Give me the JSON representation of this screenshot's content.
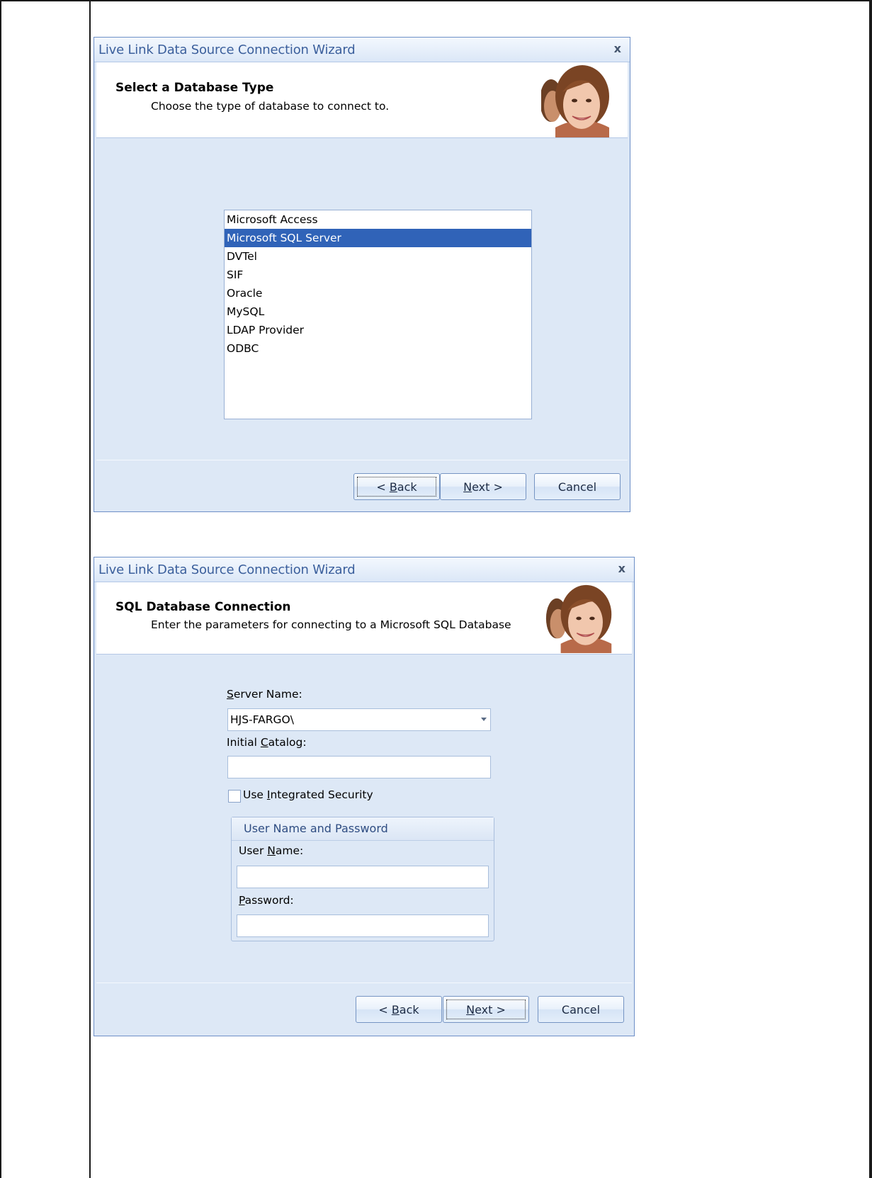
{
  "wizard1": {
    "title": "Live Link Data Source Connection Wizard",
    "close_glyph": "x",
    "header_title": "Select a Database Type",
    "header_subtitle": "Choose the type of database to connect to.",
    "database_types": [
      "Microsoft Access",
      "Microsoft SQL Server",
      "DVTel",
      "SIF",
      "Oracle",
      "MySQL",
      "LDAP Provider",
      "ODBC"
    ],
    "selected_type": "Microsoft SQL Server",
    "buttons": {
      "back_prefix": "< ",
      "back_key": "B",
      "back_rest": "ack",
      "next_key": "N",
      "next_rest": "ext >",
      "cancel": "Cancel"
    }
  },
  "wizard2": {
    "title": "Live Link Data Source Connection Wizard",
    "close_glyph": "x",
    "header_title": "SQL Database Connection",
    "header_subtitle": "Enter the parameters for connecting to a Microsoft SQL Database",
    "server_name_label": {
      "key": "S",
      "rest": "erver Name:"
    },
    "server_name_value": "HJS-FARGO\\",
    "initial_catalog_label": {
      "pre": "Initial ",
      "key": "C",
      "rest": "atalog:"
    },
    "initial_catalog_value": "",
    "integrated_security_label": {
      "pre": "Use ",
      "key": "I",
      "rest": "ntegrated Security"
    },
    "integrated_security_checked": false,
    "group_caption": "User Name and Password",
    "user_name_label": {
      "pre": "User ",
      "key": "N",
      "rest": "ame:"
    },
    "user_name_value": "",
    "password_label": {
      "key": "P",
      "rest": "assword:"
    },
    "password_value": "",
    "buttons": {
      "back_prefix": "< ",
      "back_key": "B",
      "back_rest": "ack",
      "next_key": "N",
      "next_rest": "ext >",
      "cancel": "Cancel"
    }
  },
  "colors": {
    "selection": "#3063b8",
    "title_text": "#3b5f9c",
    "dialog_body": "#dde8f6"
  }
}
